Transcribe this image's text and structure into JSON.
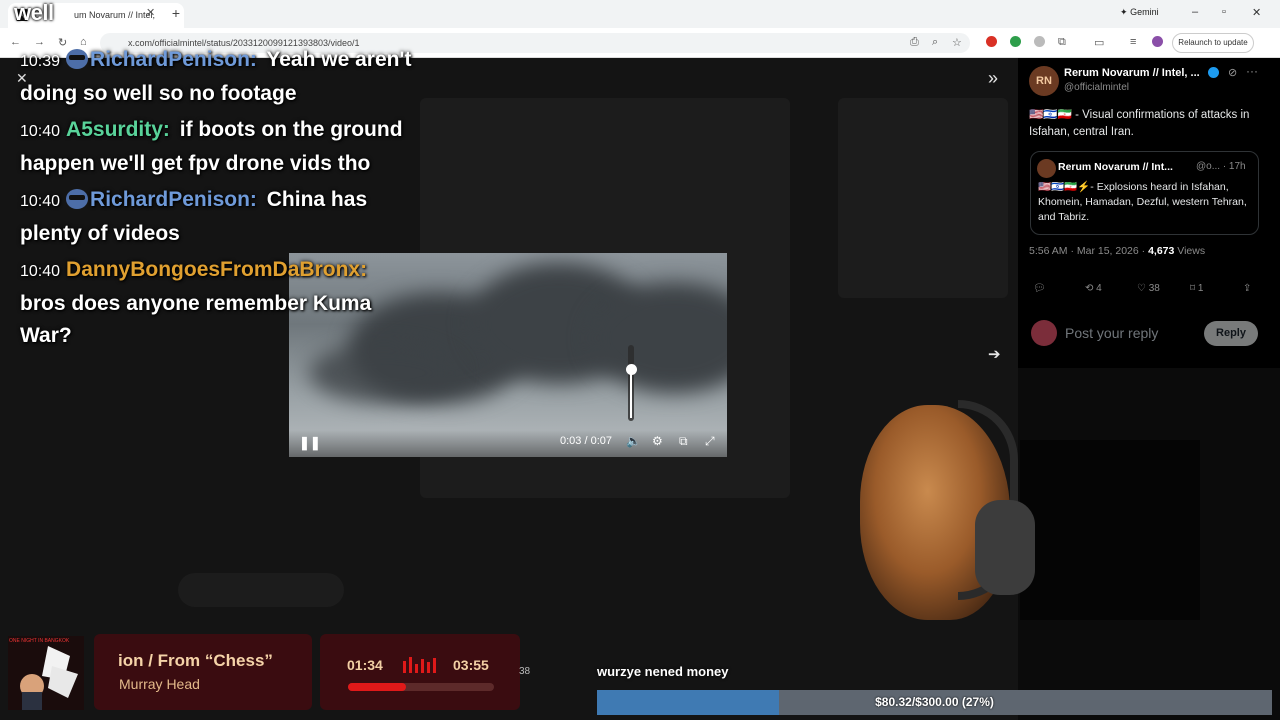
{
  "overlay_word": "well",
  "browser": {
    "tab_title": "um Novarum // Intel,",
    "url": "x.com/officialmintel/status/2033120099121393803/video/1",
    "gemini_label": "Gemini",
    "relaunch_label": "Relaunch to update"
  },
  "chat": [
    {
      "time": "10:39",
      "user": "RichardPenison:",
      "user_color": "#6f9ad9",
      "text": "Yeah we aren't doing so well so no footage",
      "emote": true
    },
    {
      "time": "10:40",
      "user": "A5surdity:",
      "user_color": "#59d39a",
      "text": "if boots on the ground happen we'll get fpv drone vids tho",
      "emote": false
    },
    {
      "time": "10:40",
      "user": "RichardPenison:",
      "user_color": "#6f9ad9",
      "text": "China has plenty of videos",
      "emote": true
    },
    {
      "time": "10:40",
      "user": "DannyBongoesFromDaBronx:",
      "user_color": "#e0a030",
      "text": "bros does anyone remember Kuma War?",
      "emote": false
    }
  ],
  "video": {
    "time_display": "0:03 / 0:07",
    "volume_fraction": 0.7
  },
  "tweet": {
    "avatar_initials": "RN",
    "author": "Rerum Novarum // Intel, ...",
    "handle": "@officialmintel",
    "text": "🇺🇸🇮🇱🇮🇷 - Visual confirmations of attacks in Isfahan, central Iran.",
    "quote": {
      "author": "Rerum Novarum // Int...",
      "meta": "@o... · 17h",
      "text": "🇺🇸🇮🇱🇮🇷⚡- Explosions heard in Isfahan, Khomein, Hamadan, Dezful, western Tehran, and Tabriz."
    },
    "timestamp": "5:56 AM · Mar 15, 2026 · ",
    "views_count": "4,673",
    "views_label": " Views",
    "retweets": "4",
    "likes": "38",
    "bookmarks": "1",
    "reply_placeholder": "Post your reply",
    "reply_button": "Reply"
  },
  "music": {
    "album_caption": "ONE NIGHT IN BANGKOK",
    "song_title": "ion / From “Chess”",
    "artist": "Murray Head",
    "elapsed": "01:34",
    "total": "03:55",
    "progress_fraction": 0.4
  },
  "side_count": "38",
  "sub_text": "wurzye nened money",
  "goal": {
    "text": "$80.32/$300.00 (27%)",
    "fraction": 0.27
  },
  "colors": {
    "accent_blue": "#1d9bf0",
    "music_red": "#e01919"
  }
}
